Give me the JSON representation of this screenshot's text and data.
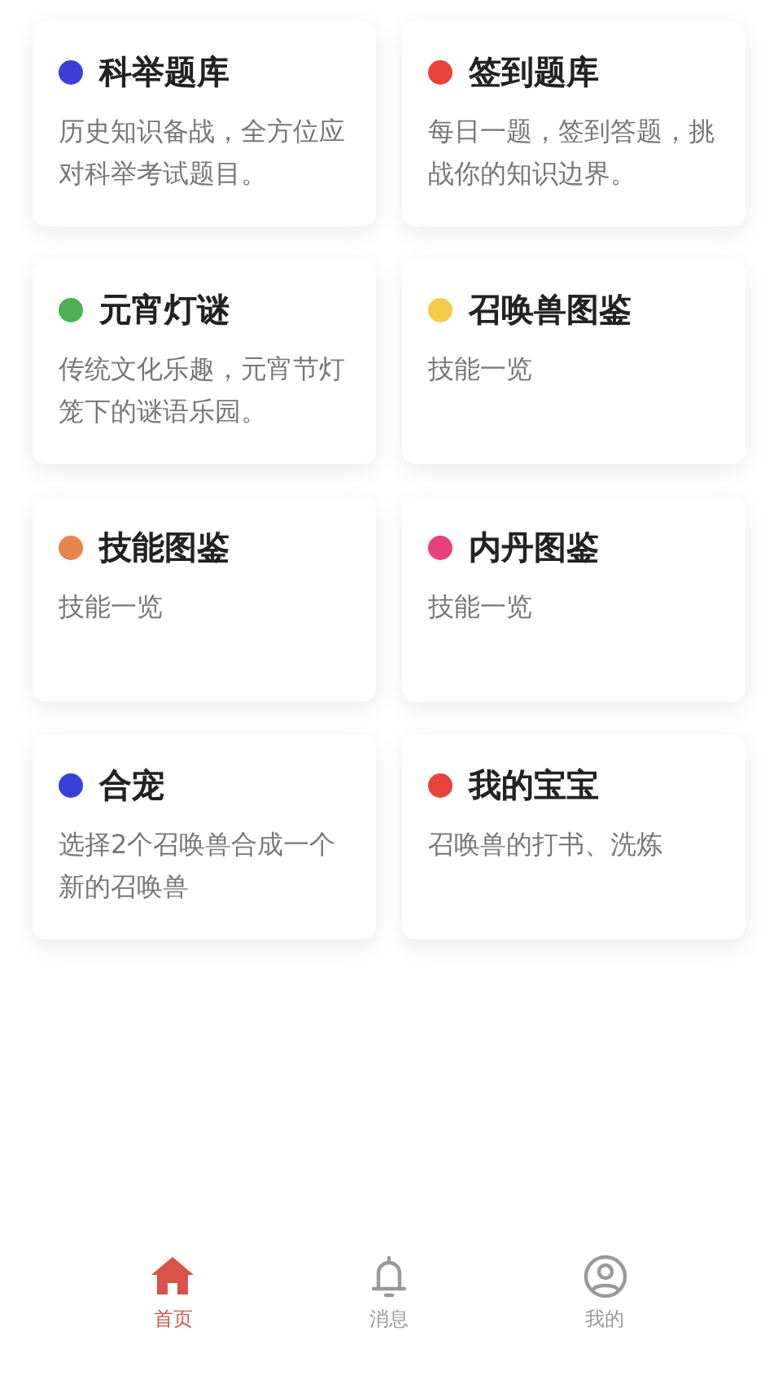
{
  "cards": [
    {
      "title": "科举题库",
      "description": "历史知识备战，全方位应对科举考试题目。",
      "color": "#3b3fd8"
    },
    {
      "title": "签到题库",
      "description": "每日一题，签到答题，挑战你的知识边界。",
      "color": "#e8433a"
    },
    {
      "title": "元宵灯谜",
      "description": "传统文化乐趣，元宵节灯笼下的谜语乐园。",
      "color": "#4caf50"
    },
    {
      "title": "召唤兽图鉴",
      "description": "技能一览",
      "color": "#f2cc4a"
    },
    {
      "title": "技能图鉴",
      "description": "技能一览",
      "color": "#e8834e"
    },
    {
      "title": "内丹图鉴",
      "description": "技能一览",
      "color": "#e8407f"
    },
    {
      "title": "合宠",
      "description": "选择2个召唤兽合成一个新的召唤兽",
      "color": "#3b3fd8"
    },
    {
      "title": "我的宝宝",
      "description": "召唤兽的打书、洗炼",
      "color": "#e8433a"
    }
  ],
  "tab_bar": [
    {
      "label": "首页",
      "kind": "home",
      "selected": true
    },
    {
      "label": "消息",
      "kind": "bell",
      "selected": false
    },
    {
      "label": "我的",
      "kind": "profile",
      "selected": false
    }
  ]
}
